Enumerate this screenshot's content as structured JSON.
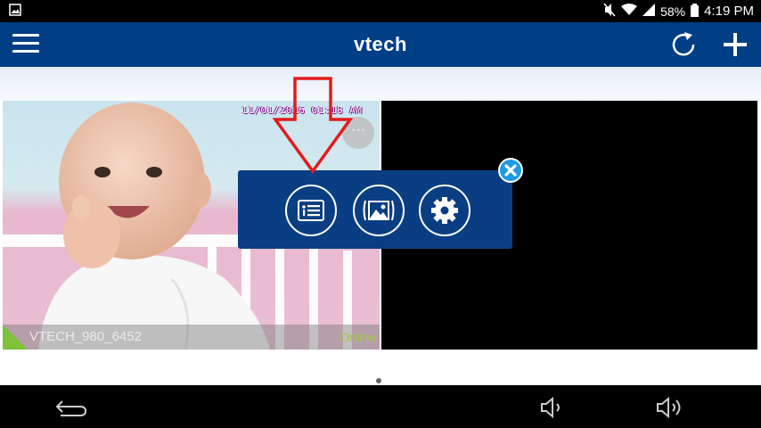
{
  "status_bar": {
    "battery": "58%",
    "time": "4:19 PM",
    "icons": [
      "gallery-notification-icon",
      "mute-icon",
      "wifi-icon",
      "signal-icon",
      "battery-icon"
    ]
  },
  "app_bar": {
    "title": "vtech",
    "icons": [
      "menu-icon",
      "refresh-icon",
      "add-icon"
    ]
  },
  "cameras": [
    {
      "timestamp": "11/01/2016 01:18 AM",
      "name": "VTECH_980_6452",
      "status": "Online",
      "status_color": "#9ccc3c",
      "more_label": "···"
    },
    {
      "empty": true
    }
  ],
  "popup_menu": {
    "items": [
      "camera-list-icon",
      "gallery-icon",
      "settings-gear-icon"
    ],
    "close_icon": "close-icon",
    "background": "#0a3e82"
  },
  "nav_bar": {
    "icons": [
      "back-icon",
      "volume-down-icon",
      "volume-up-icon"
    ]
  },
  "colors": {
    "brand_blue": "#003e85",
    "accent_blue": "#1e9ae6",
    "annotation_red": "#e31b1b"
  }
}
